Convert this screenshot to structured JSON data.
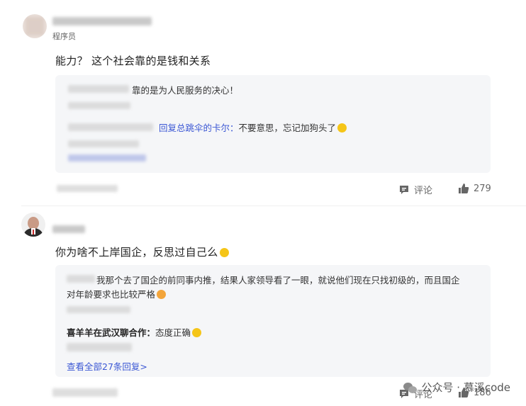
{
  "comments": [
    {
      "user_title": "程序员",
      "text": "能力？ 这个社会靠的是钱和关系",
      "replies": [
        {
          "text": "靠的是为人民服务的决心！"
        },
        {
          "prefix": "回复总跳伞的卡尔：",
          "text": "不要意思，忘记加狗头了"
        }
      ],
      "reply_label": "评论",
      "likes": "279"
    },
    {
      "text": "你为啥不上岸国企，反思过自己么",
      "replies": [
        {
          "text_line1": "我那个去了国企的前同事内推，结果人家领导看了一眼，就说他们现在只找初级的，而且国企",
          "text_line2": "对年龄要求也比较严格"
        },
        {
          "author": "喜羊羊在武汉聊合作：",
          "text": "态度正确"
        }
      ],
      "view_all": "查看全部27条回复>",
      "reply_label": "评论",
      "likes": "186"
    }
  ],
  "watermark": "公众号 · 慕溪code"
}
